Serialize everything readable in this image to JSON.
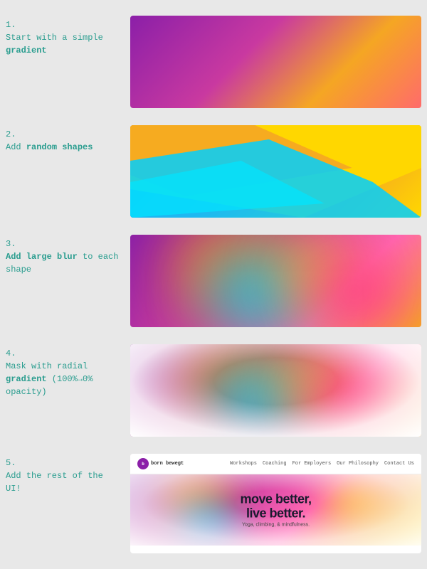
{
  "steps": [
    {
      "number": "1.",
      "description_plain": "Start with a simple ",
      "description_bold": "gradient",
      "description_after": "",
      "label_id": "step-1"
    },
    {
      "number": "2.",
      "description_plain": "Add ",
      "description_bold": "random shapes",
      "description_after": "",
      "label_id": "step-2"
    },
    {
      "number": "3.",
      "description_plain": "",
      "description_bold": "Add large blur",
      "description_after": " to each shape",
      "label_id": "step-3"
    },
    {
      "number": "4.",
      "description_plain": "Mask with radial ",
      "description_bold": "gradient",
      "description_after": " (100%→0% opacity)",
      "label_id": "step-4"
    },
    {
      "number": "5.",
      "description_plain": "Add the rest of the UI!",
      "description_bold": "",
      "description_after": "",
      "label_id": "step-5"
    }
  ],
  "ui_preview": {
    "nav_logo": "born bewegt",
    "nav_links": [
      "Workshops",
      "Coaching",
      "For Employers",
      "Our Philosophy",
      "Contact Us"
    ],
    "hero_title_line1": "move better,",
    "hero_title_line2": "live better.",
    "hero_subtitle": "Yoga, climbing, & mindfulness."
  }
}
